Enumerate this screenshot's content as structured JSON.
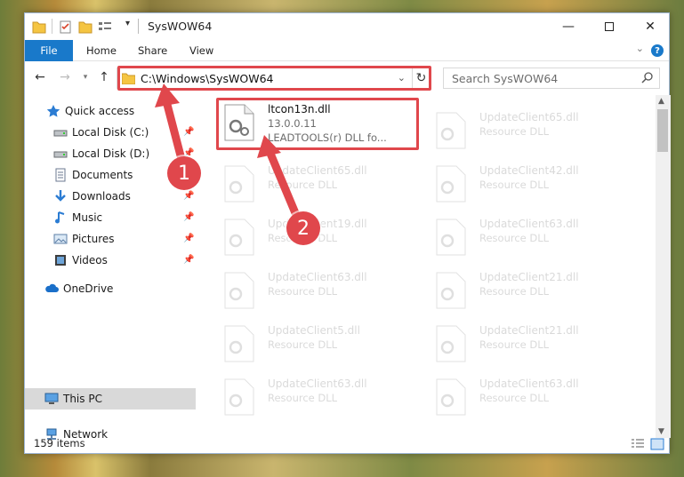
{
  "window": {
    "title": "SysWOW64"
  },
  "ribbon": {
    "tabs": [
      "File",
      "Home",
      "Share",
      "View"
    ],
    "help": "?"
  },
  "address": {
    "path": "C:\\Windows\\SysWOW64",
    "search_placeholder": "Search SysWOW64"
  },
  "sidebar": {
    "items": [
      {
        "label": "Quick access",
        "icon": "star-icon"
      },
      {
        "label": "Local Disk (C:)",
        "icon": "drive-icon",
        "pinned": true
      },
      {
        "label": "Local Disk (D:)",
        "icon": "drive-icon",
        "pinned": true
      },
      {
        "label": "Documents",
        "icon": "documents-icon",
        "pinned": true
      },
      {
        "label": "Downloads",
        "icon": "download-icon",
        "pinned": true
      },
      {
        "label": "Music",
        "icon": "music-icon",
        "pinned": true
      },
      {
        "label": "Pictures",
        "icon": "pictures-icon",
        "pinned": true
      },
      {
        "label": "Videos",
        "icon": "videos-icon",
        "pinned": true
      },
      {
        "label": "OneDrive",
        "icon": "cloud-icon"
      },
      {
        "label": "This PC",
        "icon": "pc-icon",
        "selected": true
      },
      {
        "label": "Network",
        "icon": "network-icon"
      }
    ]
  },
  "files": {
    "main": {
      "name": "ltcon13n.dll",
      "version": "13.0.0.11",
      "description": "LEADTOOLS(r) DLL fo..."
    },
    "faded_left": [
      {
        "name": "UpdateClient65.dll",
        "type": "Resource DLL"
      },
      {
        "name": "UpdateClient19.dll",
        "type": "Resource DLL"
      },
      {
        "name": "UpdateClient63.dll",
        "type": "Resource DLL"
      },
      {
        "name": "UpdateClient5.dll",
        "type": "Resource DLL"
      },
      {
        "name": "UpdateClient63.dll",
        "type": "Resource DLL"
      }
    ],
    "faded_right": [
      {
        "name": "UpdateClient65.dll",
        "type": "Resource DLL"
      },
      {
        "name": "UpdateClient42.dll",
        "type": "Resource DLL"
      },
      {
        "name": "UpdateClient63.dll",
        "type": "Resource DLL"
      },
      {
        "name": "UpdateClient21.dll",
        "type": "Resource DLL"
      },
      {
        "name": "UpdateClient21.dll",
        "type": "Resource DLL"
      },
      {
        "name": "UpdateClient63.dll",
        "type": "Resource DLL"
      }
    ]
  },
  "status": {
    "count": "159 items"
  },
  "annotations": {
    "step1": "1",
    "step2": "2",
    "color": "#e0474c"
  }
}
